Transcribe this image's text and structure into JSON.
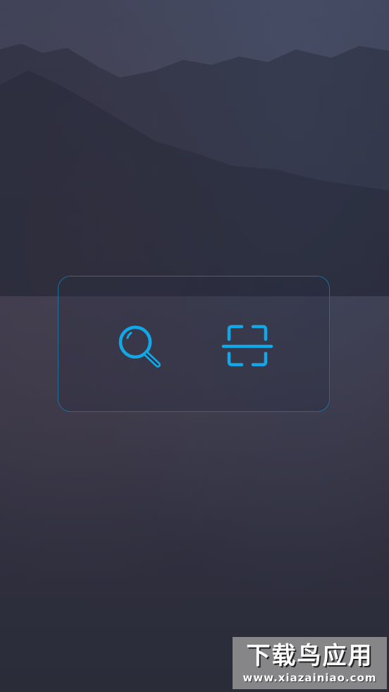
{
  "watermark": {
    "title": "下载鸟应用",
    "url": "www.xiazainiao.com"
  },
  "icons": {
    "search": "search-icon",
    "scan": "scan-icon"
  },
  "colors": {
    "accent": "#12a8e8",
    "panel_border": "#1e6e98",
    "background": "#33374a"
  }
}
